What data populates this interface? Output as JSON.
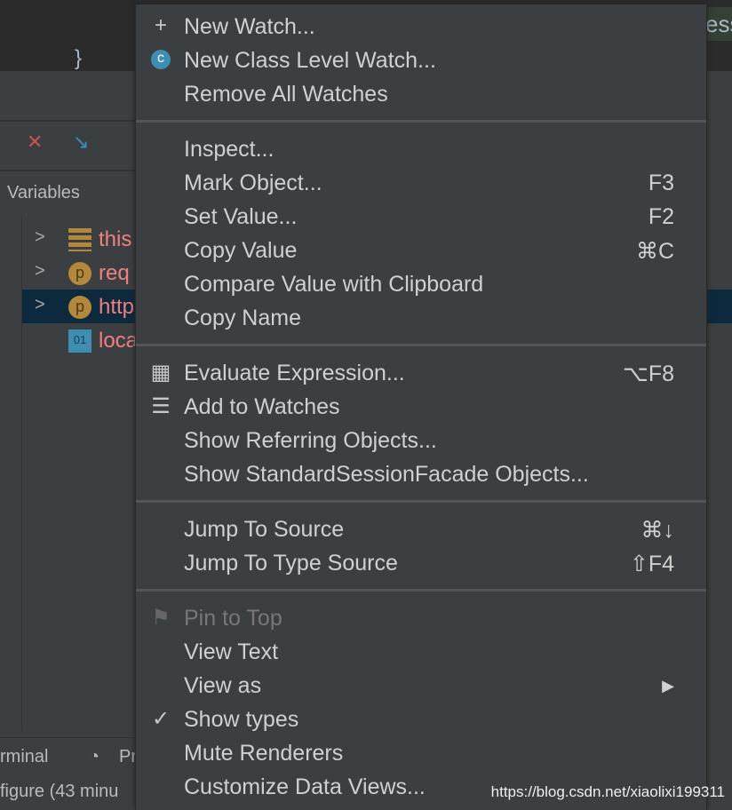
{
  "editor": {
    "brace": "}",
    "partial_text": "ess"
  },
  "debugger": {
    "variables_label": "Variables",
    "variables": [
      {
        "name": "this",
        "icon": "field-icon",
        "expandable": true,
        "selected": false
      },
      {
        "name": "req",
        "icon": "parameter-icon",
        "icon_text": "p",
        "expandable": true,
        "selected": false
      },
      {
        "name": "http",
        "icon": "parameter-icon",
        "icon_text": "p",
        "expandable": true,
        "selected": true
      },
      {
        "name": "loca",
        "icon": "primitive-icon",
        "icon_text": "01",
        "expandable": false,
        "selected": false
      }
    ]
  },
  "bottom_bar": {
    "terminal": "rminal",
    "profiler": "Pr"
  },
  "status_bar": {
    "text": "figure (43 minu"
  },
  "menu": {
    "groups": [
      [
        {
          "label": "New Watch...",
          "icon": "plus-icon",
          "glyph": "+"
        },
        {
          "label": "New Class Level Watch...",
          "icon": "class-watch-icon",
          "glyph": "c"
        },
        {
          "label": "Remove All Watches"
        }
      ],
      [
        {
          "label": "Inspect..."
        },
        {
          "label": "Mark Object...",
          "shortcut": "F3"
        },
        {
          "label": "Set Value...",
          "shortcut": "F2"
        },
        {
          "label": "Copy Value",
          "shortcut": "⌘C"
        },
        {
          "label": "Compare Value with Clipboard"
        },
        {
          "label": "Copy Name"
        }
      ],
      [
        {
          "label": "Evaluate Expression...",
          "shortcut": "⌥F8",
          "icon": "calculator-icon",
          "glyph": "▦"
        },
        {
          "label": "Add to Watches",
          "icon": "add-watch-icon",
          "glyph": "☰"
        },
        {
          "label": "Show Referring Objects..."
        },
        {
          "label": "Show StandardSessionFacade Objects..."
        }
      ],
      [
        {
          "label": "Jump To Source",
          "shortcut": "⌘↓"
        },
        {
          "label": "Jump To Type Source",
          "shortcut": "⇧F4"
        }
      ],
      [
        {
          "label": "Pin to Top",
          "icon": "flag-icon",
          "glyph": "⚑",
          "disabled": true
        },
        {
          "label": "View Text"
        },
        {
          "label": "View as",
          "submenu": true,
          "shortcut": "▶"
        },
        {
          "label": "Show types",
          "icon": "check-icon",
          "glyph": "✓"
        },
        {
          "label": "Mute Renderers"
        },
        {
          "label": "Customize Data Views..."
        }
      ]
    ]
  },
  "watermark": "https://blog.csdn.net/xiaolixi199311",
  "colors": {
    "menu_bg": "#3c3f41",
    "selection": "#0d293e",
    "var_name": "#f08080"
  }
}
